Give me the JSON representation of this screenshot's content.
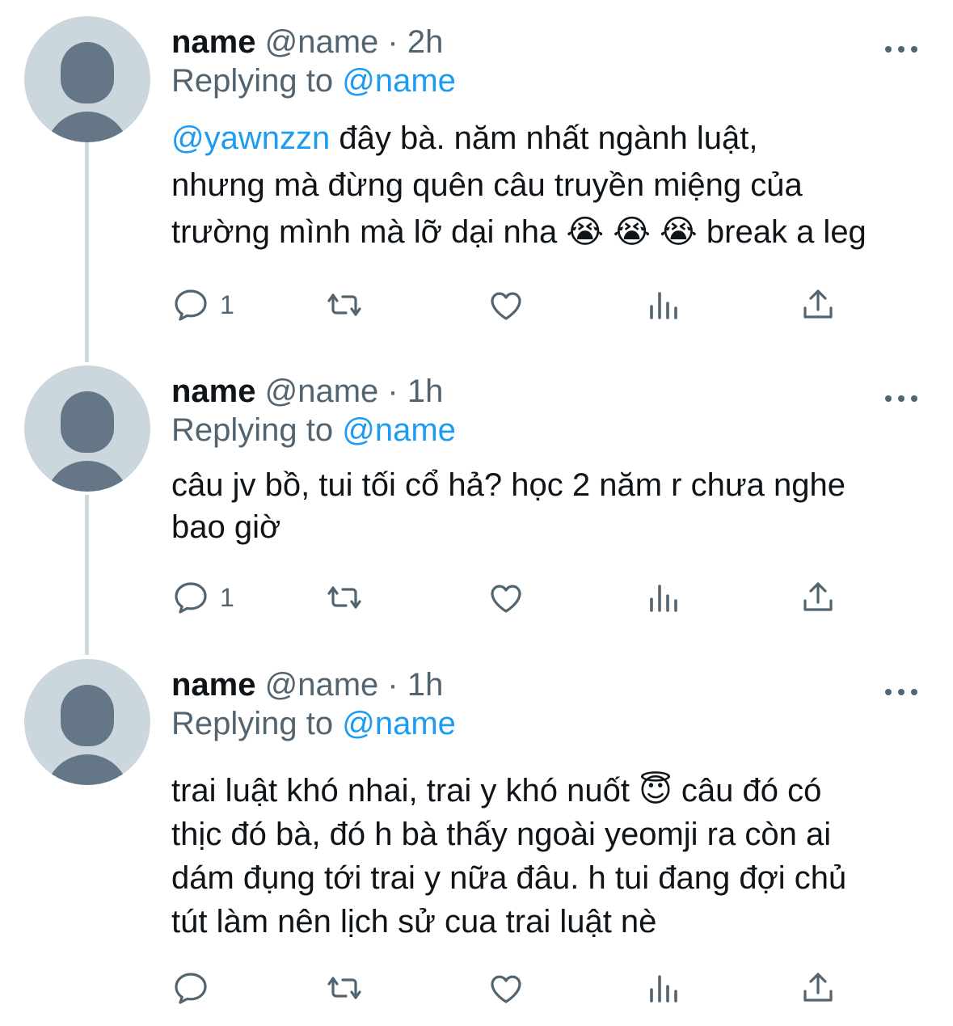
{
  "tweets": [
    {
      "name": "name",
      "handle": "@name",
      "time": "· 2h",
      "replying_label": "Replying to",
      "replying_handle": "@name",
      "text_mention": "@yawnzzn",
      "text": " đây bà. năm nhất ngành luật,\nnhưng mà đừng quên câu truyền miệng của\ntrường mình mà lỡ dại nha 😭 😭 😭  break a leg",
      "reply_count": "1"
    },
    {
      "name": "name",
      "handle": "@name",
      "time": "· 1h",
      "replying_label": "Replying to",
      "replying_handle": "@name",
      "text": "câu jv bồ, tui tối cổ hả? học 2 năm r chưa nghe\nbao giờ",
      "reply_count": "1"
    },
    {
      "name": "name",
      "handle": "@name",
      "time": "· 1h",
      "replying_label": "Replying to",
      "replying_handle": "@name",
      "text": "trai luật khó nhai, trai y khó nuốt 😇 câu đó có\nthịc đó bà, đó h bà thấy ngoài yeomji ra còn ai\ndám đụng tới trai y nữa đâu. h tui đang đợi chủ\ntút làm nên lịch sử cua trai luật nè",
      "reply_count": ""
    }
  ],
  "colors": {
    "link": "#1d9bf0",
    "secondary_text": "#536471",
    "thread_line": "#cfd9de",
    "avatar_bg": "#ccd6dd",
    "avatar_fg": "#657786"
  },
  "icons": [
    "reply-icon",
    "retweet-icon",
    "like-icon",
    "analytics-icon",
    "share-icon",
    "more-icon",
    "default-avatar-icon"
  ]
}
